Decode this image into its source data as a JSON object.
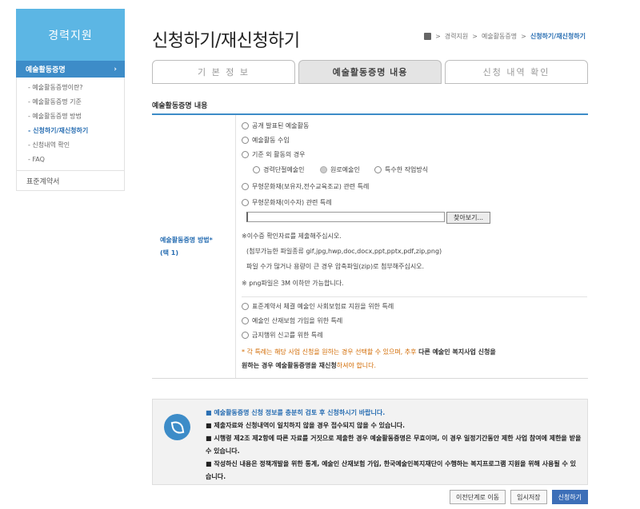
{
  "sidebar": {
    "title": "경력지원",
    "active": "예술활동증명",
    "active_arrow": "›",
    "sub": [
      "- 예술활동증명이란?",
      "- 예술활동증명 기준",
      "- 예술활동증명 방법",
      "- 신청하기/재신청하기",
      "- 신청내역 확인",
      "- FAQ"
    ],
    "extra": "표준계약서"
  },
  "header": {
    "title": "신청하기/재신청하기",
    "crumbs": [
      "경력지원",
      "예술활동증명",
      "신청하기/재신청하기"
    ],
    "sep": ">"
  },
  "tabs": [
    "기 본 정 보",
    "예술활동증명 내용",
    "신청 내역 확인"
  ],
  "section": {
    "title": "예술활동증명 내용",
    "label_line1": "예술활동증명 방법*",
    "label_line2": "(택 1)"
  },
  "options": {
    "o1": "공개 발표된 예술활동",
    "o2": "예술활동 수입",
    "o3": "기준 외 활동의 경우",
    "o3a": "경력단절예술인",
    "o3b": "원로예술인",
    "o3c": "특수한 작업방식",
    "o4": "무형문화재(보유자,전수교육조교) 관련 특례",
    "o5": "무형문화재(이수자) 관련 특례",
    "file_btn": "찾아보기...",
    "note1": "※이수증 확인자료를 제출해주십시오.",
    "note2": "(첨부가능한 파일종류 gif,jpg,hwp,doc,docx,ppt,pptx,pdf,zip,png)",
    "note3": "파일 수가 많거나 용량이 큰 경우 압축파일(zip)로 첨부해주십시오.",
    "note4": "※ png파일은 3M 이하만 가능합니다.",
    "s1": "표준계약서 체결 예술인 사회보험료 지원을 위한 특례",
    "s2": "예술인 산재보험 가입을 위한 특례",
    "s3": "금지행위 신고를 위한 특례",
    "warn_a": "* 각 특례는 해당 사업 신청을 원하는 경우 선택할 수 있으며, 추후 ",
    "warn_b": "다른 예술인 복지사업 신청을",
    "warn_c": "원하는 경우 예술활동증명을 재신청",
    "warn_d": "하셔야 합니다."
  },
  "notice": {
    "head": "■ 예술활동증명 신청 정보를 충분히 검토 후 신청하시기 바랍니다.",
    "l1": "■ 제출자료와 신청내역이 일치하지 않을 경우 접수되지 않을 수 있습니다.",
    "l2": "■ 시행령 제2조 제2항에 따른 자료를 거짓으로 제출한 경우 예술활동증명은 무효이며, 이 경우 일정기간동안 제한 사업 참여에 제한을 받을 수 있습니다.",
    "l3": "■ 작성하신 내용은 정책개발을 위한 통계, 예술인 산재보험 가입, 한국예술인복지재단이 수행하는 복지프로그램 지원을 위해 사용될 수 있습니다."
  },
  "buttons": {
    "prev": "이전단계로 이동",
    "save": "임시저장",
    "submit": "신청하기"
  },
  "colors": {
    "accent": "#3d8cc8",
    "sidebar_head": "#5cb6e4",
    "primary_btn": "#3d6fb8"
  }
}
